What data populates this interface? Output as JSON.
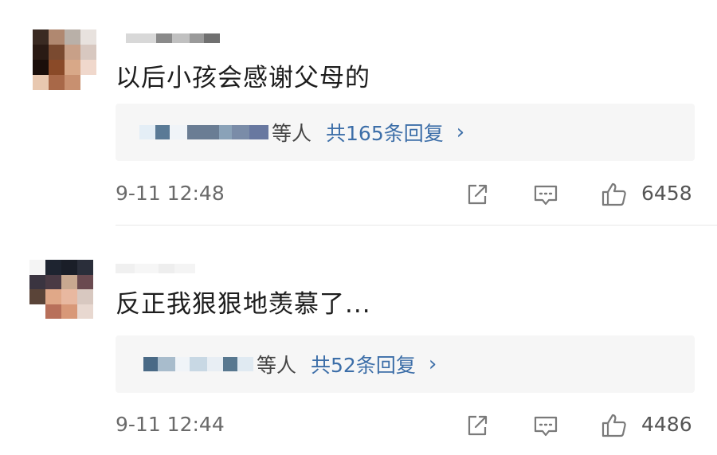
{
  "comments": [
    {
      "text": "以后小孩会感谢父母的",
      "reply_suffix": "等人",
      "reply_count_text": "共165条回复",
      "chevron": "›",
      "timestamp": "9-11 12:48",
      "like_count": "6458",
      "icons": [
        "share-icon",
        "reply-icon",
        "like-icon"
      ]
    },
    {
      "text": "反正我狠狠地羡慕了...",
      "reply_suffix": "等人",
      "reply_count_text": "共52条回复",
      "chevron": "›",
      "timestamp": "9-11 12:44",
      "like_count": "4486",
      "icons": [
        "share-icon",
        "reply-icon",
        "like-icon"
      ]
    }
  ],
  "colors": {
    "link": "#3c6ea8",
    "reply_box_bg": "#f6f6f6",
    "meta_text": "#6a6a6a",
    "icon_stroke": "#7a7a7a"
  }
}
